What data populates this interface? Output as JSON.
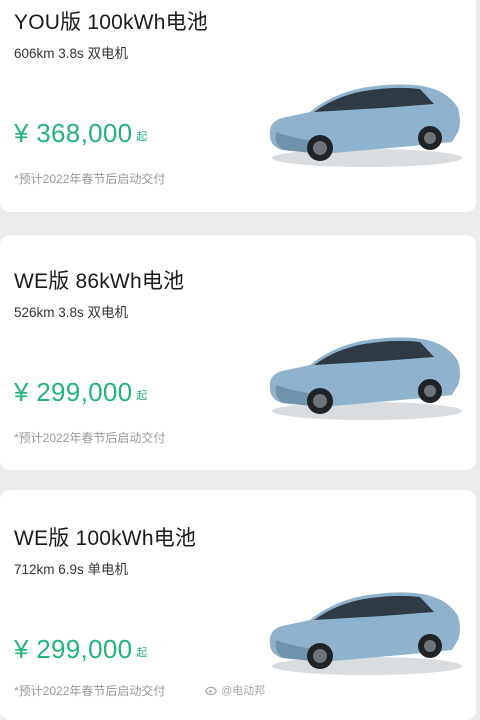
{
  "cards": [
    {
      "title": "YOU版 100kWh电池",
      "spec": "606km 3.8s 双电机",
      "price": "¥ 368,000",
      "price_unit": "起",
      "note": "*预计2022年春节后启动交付"
    },
    {
      "title": "WE版 86kWh电池",
      "spec": "526km 3.8s 双电机",
      "price": "¥ 299,000",
      "price_unit": "起",
      "note": "*预计2022年春节后启动交付"
    },
    {
      "title": "WE版 100kWh电池",
      "spec": "712km 6.9s 单电机",
      "price": "¥ 299,000",
      "price_unit": "起",
      "note": "*预计2022年春节后启动交付"
    }
  ],
  "watermark": {
    "text": "@电动邦",
    "icon": "weibo-icon"
  },
  "colors": {
    "price": "#22b47a",
    "card": "#ffffff",
    "background": "#ececed",
    "car_body": "#8fb3cc"
  }
}
